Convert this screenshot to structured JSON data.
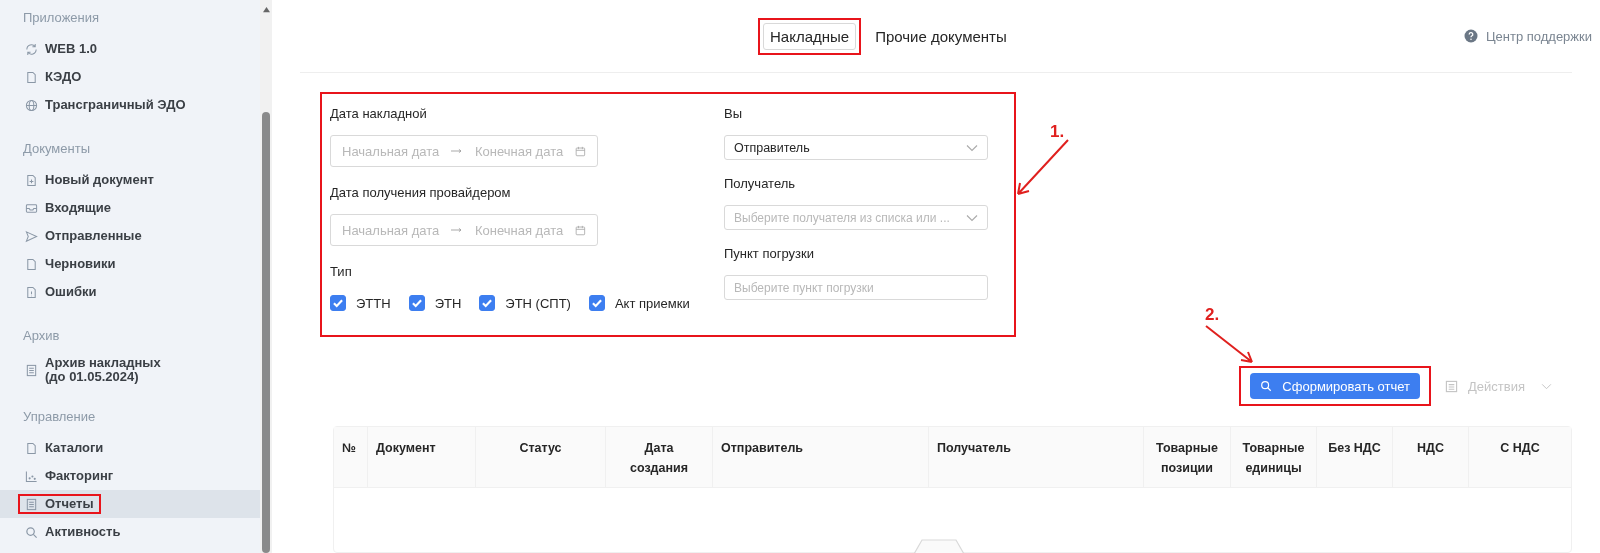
{
  "sidebar": {
    "sections": [
      {
        "title": "Приложения",
        "items": [
          {
            "label": "WEB 1.0",
            "selected": false,
            "highlighted": false
          },
          {
            "label": "КЭДО",
            "selected": false,
            "highlighted": false
          },
          {
            "label": "Трансграничный ЭДО",
            "selected": false,
            "highlighted": false
          }
        ]
      },
      {
        "title": "Документы",
        "items": [
          {
            "label": "Новый документ",
            "selected": false,
            "highlighted": false
          },
          {
            "label": "Входящие",
            "selected": false,
            "highlighted": false
          },
          {
            "label": "Отправленные",
            "selected": false,
            "highlighted": false
          },
          {
            "label": "Черновики",
            "selected": false,
            "highlighted": false
          },
          {
            "label": "Ошибки",
            "selected": false,
            "highlighted": false
          }
        ]
      },
      {
        "title": "Архив",
        "items": [
          {
            "label": "Архив накладных\n(до 01.05.2024)",
            "selected": false,
            "highlighted": false
          }
        ]
      },
      {
        "title": "Управление",
        "items": [
          {
            "label": "Каталоги",
            "selected": false,
            "highlighted": false
          },
          {
            "label": "Факторинг",
            "selected": false,
            "highlighted": false
          },
          {
            "label": "Отчеты",
            "selected": true,
            "highlighted": true
          },
          {
            "label": "Активность",
            "selected": false,
            "highlighted": false
          }
        ]
      }
    ]
  },
  "tabs": [
    {
      "label": "Накладные",
      "selected": true,
      "highlighted": true
    },
    {
      "label": "Прочие документы",
      "selected": false,
      "highlighted": false
    }
  ],
  "support_link": "Центр поддержки",
  "filters": {
    "highlighted": true,
    "annotation": "1.",
    "invoice_date": {
      "label": "Дата накладной",
      "start_placeholder": "Начальная дата",
      "end_placeholder": "Конечная дата"
    },
    "provider_date": {
      "label": "Дата получения провайдером",
      "start_placeholder": "Начальная дата",
      "end_placeholder": "Конечная дата"
    },
    "type": {
      "label": "Тип",
      "options": [
        {
          "label": "ЭТТН",
          "checked": true
        },
        {
          "label": "ЭТН",
          "checked": true
        },
        {
          "label": "ЭТН (СПТ)",
          "checked": true
        },
        {
          "label": "Акт приемки",
          "checked": true
        }
      ]
    },
    "you": {
      "label": "Вы",
      "value": "Отправитель"
    },
    "recipient": {
      "label": "Получатель",
      "placeholder": "Выберите получателя из списка или ..."
    },
    "loading_point": {
      "label": "Пункт погрузки",
      "placeholder": "Выберите пункт погрузки"
    }
  },
  "report_button": {
    "label": "Сформировать отчет",
    "highlighted": true,
    "annotation": "2."
  },
  "actions_button": {
    "label": "Действия",
    "disabled": true
  },
  "table": {
    "columns": [
      "№",
      "Документ",
      "Статус",
      "Дата создания",
      "Отправитель",
      "Получатель",
      "Товарные позиции",
      "Товарные единицы",
      "Без НДС",
      "НДС",
      "С НДС"
    ]
  }
}
